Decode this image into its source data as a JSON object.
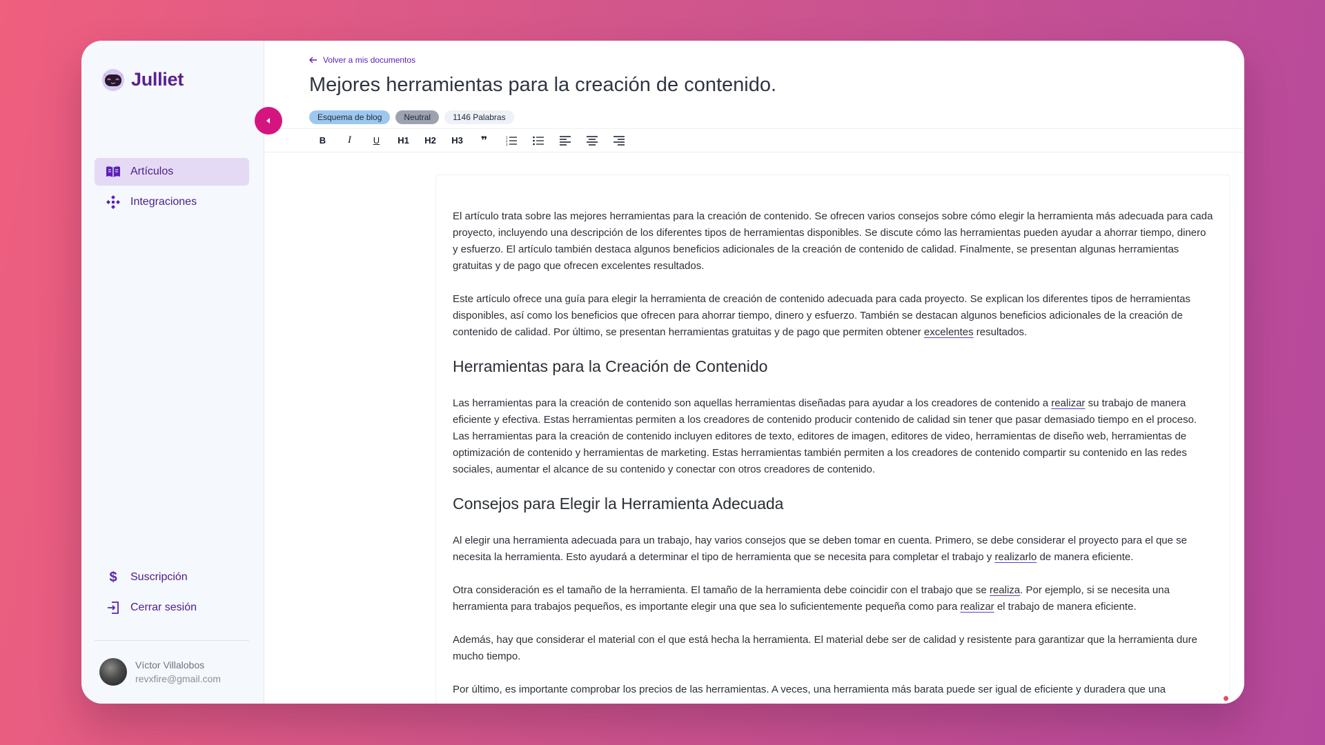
{
  "app": {
    "name": "Julliet",
    "brand_color": "#5b1f91",
    "accent_color": "#d5157f"
  },
  "sidebar": {
    "nav": [
      {
        "label": "Artículos",
        "icon": "book-icon",
        "active": true
      },
      {
        "label": "Integraciones",
        "icon": "integrations-icon",
        "active": false
      }
    ],
    "bottom": [
      {
        "label": "Suscripción",
        "icon": "dollar-icon"
      },
      {
        "label": "Cerrar sesión",
        "icon": "logout-icon"
      }
    ],
    "user": {
      "name": "Víctor Villalobos",
      "email": "revxfire@gmail.com"
    }
  },
  "header": {
    "back_label": "Volver a mis documentos",
    "title": "Mejores herramientas para la creación de contenido.",
    "badges": [
      "Esquema de blog",
      "Neutral",
      "1146 Palabras"
    ]
  },
  "toolbar": {
    "bold": "B",
    "italic": "I",
    "underline": "U",
    "h1": "H1",
    "h2": "H2",
    "h3": "H3",
    "quote": "❞"
  },
  "content": {
    "p1": "El artículo trata sobre las mejores herramientas para la creación de contenido. Se ofrecen varios consejos sobre cómo elegir la herramienta más adecuada para cada proyecto, incluyendo una descripción de los diferentes tipos de herramientas disponibles. Se discute cómo las herramientas pueden ayudar a ahorrar tiempo, dinero y esfuerzo. El artículo también destaca algunos beneficios adicionales de la creación de contenido de calidad. Finalmente, se presentan algunas herramientas gratuitas y de pago que ofrecen excelentes resultados.",
    "p2_a": "Este artículo ofrece una guía para elegir la herramienta de creación de contenido adecuada para cada proyecto. Se explican los diferentes tipos de herramientas disponibles, así como los beneficios que ofrecen para ahorrar tiempo, dinero y esfuerzo. También se destacan algunos beneficios adicionales de la creación de contenido de calidad. Por último, se presentan herramientas gratuitas y de pago que permiten obtener ",
    "p2_u": "excelentes",
    "p2_b": " resultados.",
    "h_1": "Herramientas para la Creación de Contenido",
    "p3_a": "Las herramientas para la creación de contenido son aquellas herramientas diseñadas para ayudar a los creadores de contenido a ",
    "p3_u": "realizar",
    "p3_b": " su trabajo de manera eficiente y efectiva. Estas herramientas permiten a los creadores de contenido producir contenido de calidad sin tener que pasar demasiado tiempo en el proceso. Las herramientas para la creación de contenido incluyen editores de texto, editores de imagen, editores de video, herramientas de diseño web, herramientas de optimización de contenido y herramientas de marketing. Estas herramientas también permiten a los creadores de contenido compartir su contenido en las redes sociales, aumentar el alcance de su contenido y conectar con otros creadores de contenido.",
    "h_2": "Consejos para Elegir la Herramienta Adecuada",
    "p4_a": "Al elegir una herramienta adecuada para un trabajo, hay varios consejos que se deben tomar en cuenta. Primero, se debe considerar el proyecto para el que se necesita la herramienta. Esto ayudará a determinar el tipo de herramienta que se necesita para completar el trabajo y ",
    "p4_u": "realizarlo",
    "p4_b": " de manera eficiente.",
    "p5_a": "Otra consideración es el tamaño de la herramienta. El tamaño de la herramienta debe coincidir con el trabajo que se ",
    "p5_u1": "realiza",
    "p5_b": ". Por ejemplo, si se necesita una herramienta para trabajos pequeños, es importante elegir una que sea lo suficientemente pequeña como para ",
    "p5_u2": "realizar",
    "p5_c": " el trabajo de manera eficiente.",
    "p6": "Además, hay que considerar el material con el que está hecha la herramienta. El material debe ser de calidad y resistente para garantizar que la herramienta dure mucho tiempo.",
    "p7": "Por último, es importante comprobar los precios de las herramientas. A veces, una herramienta más barata puede ser igual de eficiente y duradera que una"
  }
}
